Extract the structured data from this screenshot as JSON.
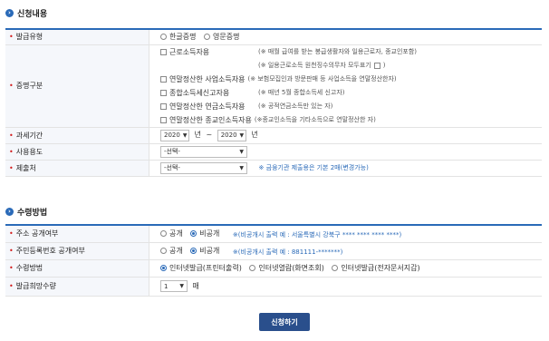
{
  "section1": {
    "title": "신청내용"
  },
  "fields": {
    "issue_type": {
      "label": "발급유형",
      "options": [
        "한글증명",
        "영문증명"
      ],
      "selected": ""
    },
    "cert_type": {
      "label": "증명구분",
      "items": [
        {
          "name": "근로소득자용",
          "note": "(※ 매월 급여를 받는 봉급생활자와 일용근로자, 종교인포함)"
        },
        {
          "name": "",
          "note": "(※ 일용근로소득 원천징수의무자 모두표기",
          "note_end": ")"
        },
        {
          "name": "연말정산한 사업소득자용",
          "note": "(※ 보험모집인과 방문판매 등 사업소득을 연말정산한자)"
        },
        {
          "name": "종합소득세신고자용",
          "note": "(※ 매년 5월 종합소득세 신고자)"
        },
        {
          "name": "연말정산한 연금소득자용",
          "note": "(※ 공적연금소득만 있는 자)"
        },
        {
          "name": "연말정산한 종교인소득자용",
          "note": "(※종교인소득을 기타소득으로 연말정산한 자)"
        }
      ]
    },
    "tax_period": {
      "label": "과세기간",
      "from": "2020",
      "to": "2020",
      "unit": "년",
      "sep": "~"
    },
    "usage": {
      "label": "사용용도",
      "value": "-선택-"
    },
    "submit_to": {
      "label": "제출처",
      "value": "-선택-",
      "note": "※ 금융기관 제출용은 기본 2매(변경가능)"
    }
  },
  "section2": {
    "title": "수령방법"
  },
  "receive": {
    "addr_public": {
      "label": "주소 공개여부",
      "options": [
        "공개",
        "비공개"
      ],
      "selected": "비공개",
      "note": "※(비공개시 출력 예 : 서울특별시 강북구 **** **** **** ****)"
    },
    "rrn_public": {
      "label": "주민등록번호 공개여부",
      "options": [
        "공개",
        "비공개"
      ],
      "selected": "비공개",
      "note": "※(비공개시 출력 예 : 881111-*******)"
    },
    "method": {
      "label": "수령방법",
      "options": [
        "인터넷발급(프린터출력)",
        "인터넷열람(화면조회)",
        "인터넷발급(전자문서지갑)"
      ],
      "selected": "인터넷발급(프린터출력)"
    },
    "quantity": {
      "label": "발급희망수량",
      "value": "1",
      "unit": "매"
    }
  },
  "apply_button": "신청하기"
}
